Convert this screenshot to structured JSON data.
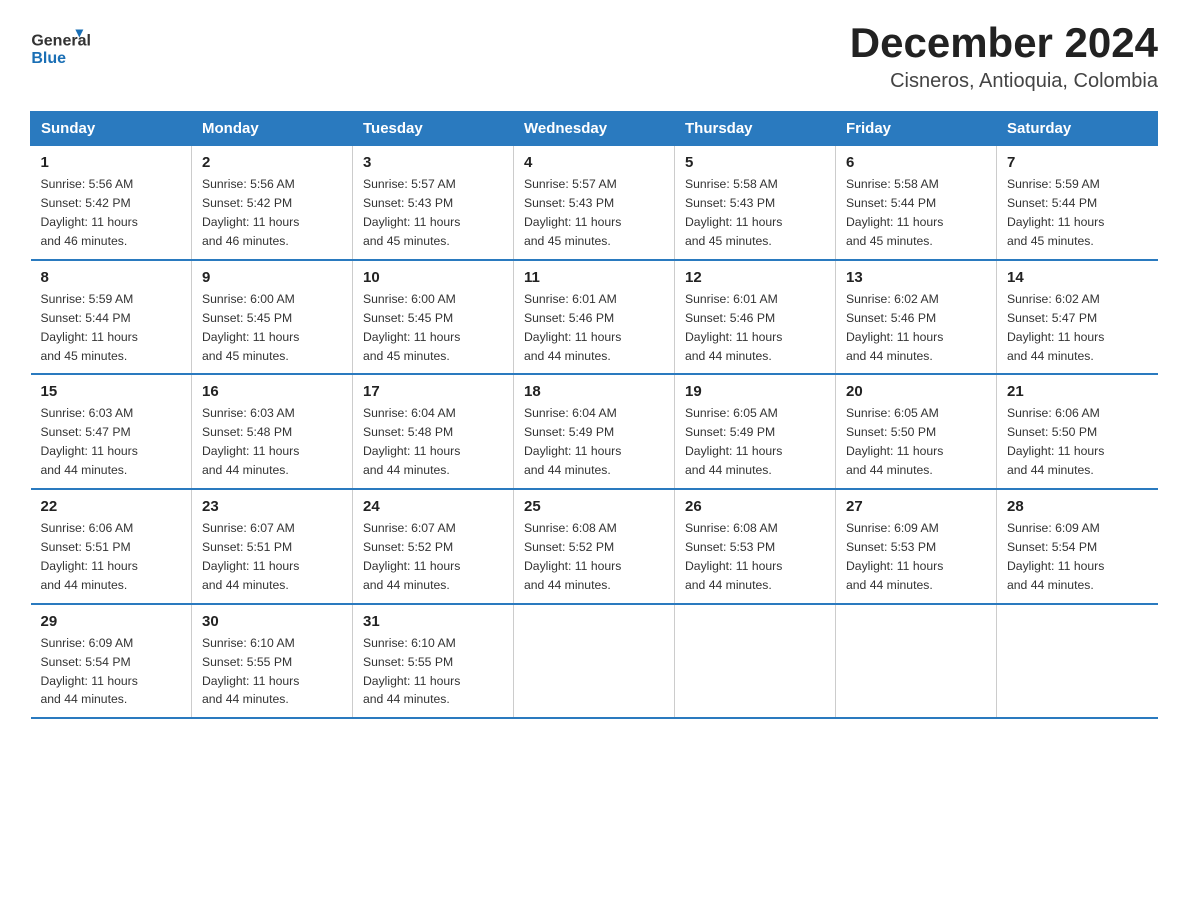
{
  "logo": {
    "text_general": "General",
    "text_blue": "Blue",
    "arrow_alt": "logo arrow"
  },
  "title": "December 2024",
  "subtitle": "Cisneros, Antioquia, Colombia",
  "days_of_week": [
    "Sunday",
    "Monday",
    "Tuesday",
    "Wednesday",
    "Thursday",
    "Friday",
    "Saturday"
  ],
  "weeks": [
    [
      {
        "day": "1",
        "info": "Sunrise: 5:56 AM\nSunset: 5:42 PM\nDaylight: 11 hours\nand 46 minutes."
      },
      {
        "day": "2",
        "info": "Sunrise: 5:56 AM\nSunset: 5:42 PM\nDaylight: 11 hours\nand 46 minutes."
      },
      {
        "day": "3",
        "info": "Sunrise: 5:57 AM\nSunset: 5:43 PM\nDaylight: 11 hours\nand 45 minutes."
      },
      {
        "day": "4",
        "info": "Sunrise: 5:57 AM\nSunset: 5:43 PM\nDaylight: 11 hours\nand 45 minutes."
      },
      {
        "day": "5",
        "info": "Sunrise: 5:58 AM\nSunset: 5:43 PM\nDaylight: 11 hours\nand 45 minutes."
      },
      {
        "day": "6",
        "info": "Sunrise: 5:58 AM\nSunset: 5:44 PM\nDaylight: 11 hours\nand 45 minutes."
      },
      {
        "day": "7",
        "info": "Sunrise: 5:59 AM\nSunset: 5:44 PM\nDaylight: 11 hours\nand 45 minutes."
      }
    ],
    [
      {
        "day": "8",
        "info": "Sunrise: 5:59 AM\nSunset: 5:44 PM\nDaylight: 11 hours\nand 45 minutes."
      },
      {
        "day": "9",
        "info": "Sunrise: 6:00 AM\nSunset: 5:45 PM\nDaylight: 11 hours\nand 45 minutes."
      },
      {
        "day": "10",
        "info": "Sunrise: 6:00 AM\nSunset: 5:45 PM\nDaylight: 11 hours\nand 45 minutes."
      },
      {
        "day": "11",
        "info": "Sunrise: 6:01 AM\nSunset: 5:46 PM\nDaylight: 11 hours\nand 44 minutes."
      },
      {
        "day": "12",
        "info": "Sunrise: 6:01 AM\nSunset: 5:46 PM\nDaylight: 11 hours\nand 44 minutes."
      },
      {
        "day": "13",
        "info": "Sunrise: 6:02 AM\nSunset: 5:46 PM\nDaylight: 11 hours\nand 44 minutes."
      },
      {
        "day": "14",
        "info": "Sunrise: 6:02 AM\nSunset: 5:47 PM\nDaylight: 11 hours\nand 44 minutes."
      }
    ],
    [
      {
        "day": "15",
        "info": "Sunrise: 6:03 AM\nSunset: 5:47 PM\nDaylight: 11 hours\nand 44 minutes."
      },
      {
        "day": "16",
        "info": "Sunrise: 6:03 AM\nSunset: 5:48 PM\nDaylight: 11 hours\nand 44 minutes."
      },
      {
        "day": "17",
        "info": "Sunrise: 6:04 AM\nSunset: 5:48 PM\nDaylight: 11 hours\nand 44 minutes."
      },
      {
        "day": "18",
        "info": "Sunrise: 6:04 AM\nSunset: 5:49 PM\nDaylight: 11 hours\nand 44 minutes."
      },
      {
        "day": "19",
        "info": "Sunrise: 6:05 AM\nSunset: 5:49 PM\nDaylight: 11 hours\nand 44 minutes."
      },
      {
        "day": "20",
        "info": "Sunrise: 6:05 AM\nSunset: 5:50 PM\nDaylight: 11 hours\nand 44 minutes."
      },
      {
        "day": "21",
        "info": "Sunrise: 6:06 AM\nSunset: 5:50 PM\nDaylight: 11 hours\nand 44 minutes."
      }
    ],
    [
      {
        "day": "22",
        "info": "Sunrise: 6:06 AM\nSunset: 5:51 PM\nDaylight: 11 hours\nand 44 minutes."
      },
      {
        "day": "23",
        "info": "Sunrise: 6:07 AM\nSunset: 5:51 PM\nDaylight: 11 hours\nand 44 minutes."
      },
      {
        "day": "24",
        "info": "Sunrise: 6:07 AM\nSunset: 5:52 PM\nDaylight: 11 hours\nand 44 minutes."
      },
      {
        "day": "25",
        "info": "Sunrise: 6:08 AM\nSunset: 5:52 PM\nDaylight: 11 hours\nand 44 minutes."
      },
      {
        "day": "26",
        "info": "Sunrise: 6:08 AM\nSunset: 5:53 PM\nDaylight: 11 hours\nand 44 minutes."
      },
      {
        "day": "27",
        "info": "Sunrise: 6:09 AM\nSunset: 5:53 PM\nDaylight: 11 hours\nand 44 minutes."
      },
      {
        "day": "28",
        "info": "Sunrise: 6:09 AM\nSunset: 5:54 PM\nDaylight: 11 hours\nand 44 minutes."
      }
    ],
    [
      {
        "day": "29",
        "info": "Sunrise: 6:09 AM\nSunset: 5:54 PM\nDaylight: 11 hours\nand 44 minutes."
      },
      {
        "day": "30",
        "info": "Sunrise: 6:10 AM\nSunset: 5:55 PM\nDaylight: 11 hours\nand 44 minutes."
      },
      {
        "day": "31",
        "info": "Sunrise: 6:10 AM\nSunset: 5:55 PM\nDaylight: 11 hours\nand 44 minutes."
      },
      null,
      null,
      null,
      null
    ]
  ]
}
